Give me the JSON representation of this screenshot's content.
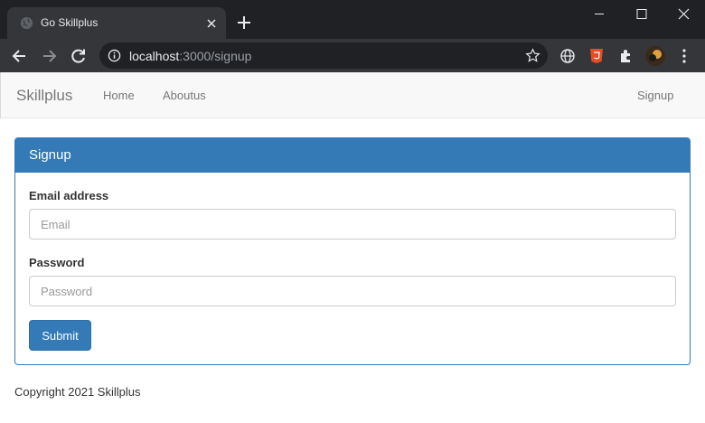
{
  "browser": {
    "tab_title": "Go Skillplus",
    "url_host": "localhost",
    "url_rest": ":3000/signup"
  },
  "navbar": {
    "brand": "Skillplus",
    "links": [
      "Home",
      "Aboutus"
    ],
    "right_link": "Signup"
  },
  "form": {
    "heading": "Signup",
    "email_label": "Email address",
    "email_placeholder": "Email",
    "password_label": "Password",
    "password_placeholder": "Password",
    "submit_label": "Submit"
  },
  "footer": {
    "text": "Copyright 2021 Skillplus"
  },
  "colors": {
    "primary": "#337ab7",
    "navbar_bg": "#f8f8f8",
    "chrome_dark": "#202124",
    "chrome_toolbar": "#35363a"
  }
}
